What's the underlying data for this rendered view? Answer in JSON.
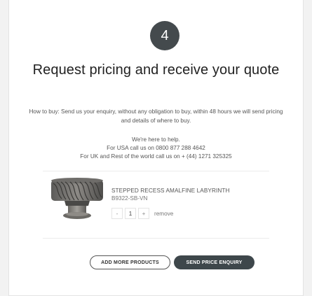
{
  "step": {
    "number": "4"
  },
  "heading": "Request pricing and receive your quote",
  "info": {
    "how_to_buy": "How to buy: Send us your enquiry, without any obligation to buy, within 48 hours we will send pricing and details of where to buy.",
    "help": "We're here to help.",
    "usa": "For USA call us on 0800 877 288 4642",
    "uk": "For UK and Rest of the world call us on + (44) 1271 325325"
  },
  "product": {
    "name": "STEPPED RECESS AMALFINE LABYRINTH",
    "code": "B9322-SB-VN",
    "quantity": "1",
    "minus": "-",
    "plus": "+",
    "remove_label": "remove"
  },
  "buttons": {
    "add_more": "ADD MORE PRODUCTS",
    "send_enquiry": "SEND PRICE ENQUIRY"
  },
  "colors": {
    "accent": "#3e474b",
    "circle": "#444a4d"
  }
}
